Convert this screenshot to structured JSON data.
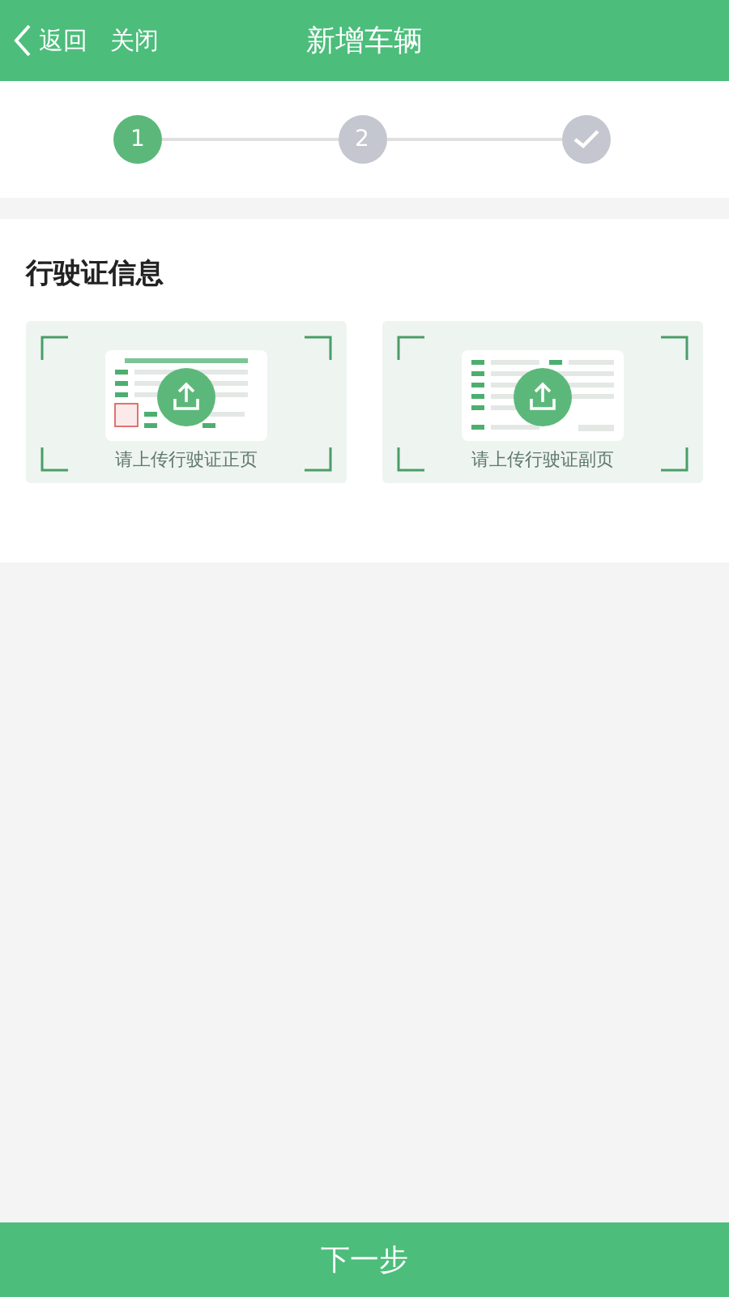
{
  "header": {
    "back": "返回",
    "close": "关闭",
    "title": "新增车辆"
  },
  "steps": [
    {
      "kind": "number",
      "label": "1",
      "selected": true
    },
    {
      "kind": "number",
      "label": "2",
      "selected": false
    },
    {
      "kind": "finish",
      "selected": false
    }
  ],
  "section": {
    "title": "行驶证信息",
    "uploads": [
      {
        "kind": "front",
        "label": "请上传行驶证正页"
      },
      {
        "kind": "back",
        "label": "请上传行驶证副页"
      }
    ]
  },
  "next_button": "下一步"
}
